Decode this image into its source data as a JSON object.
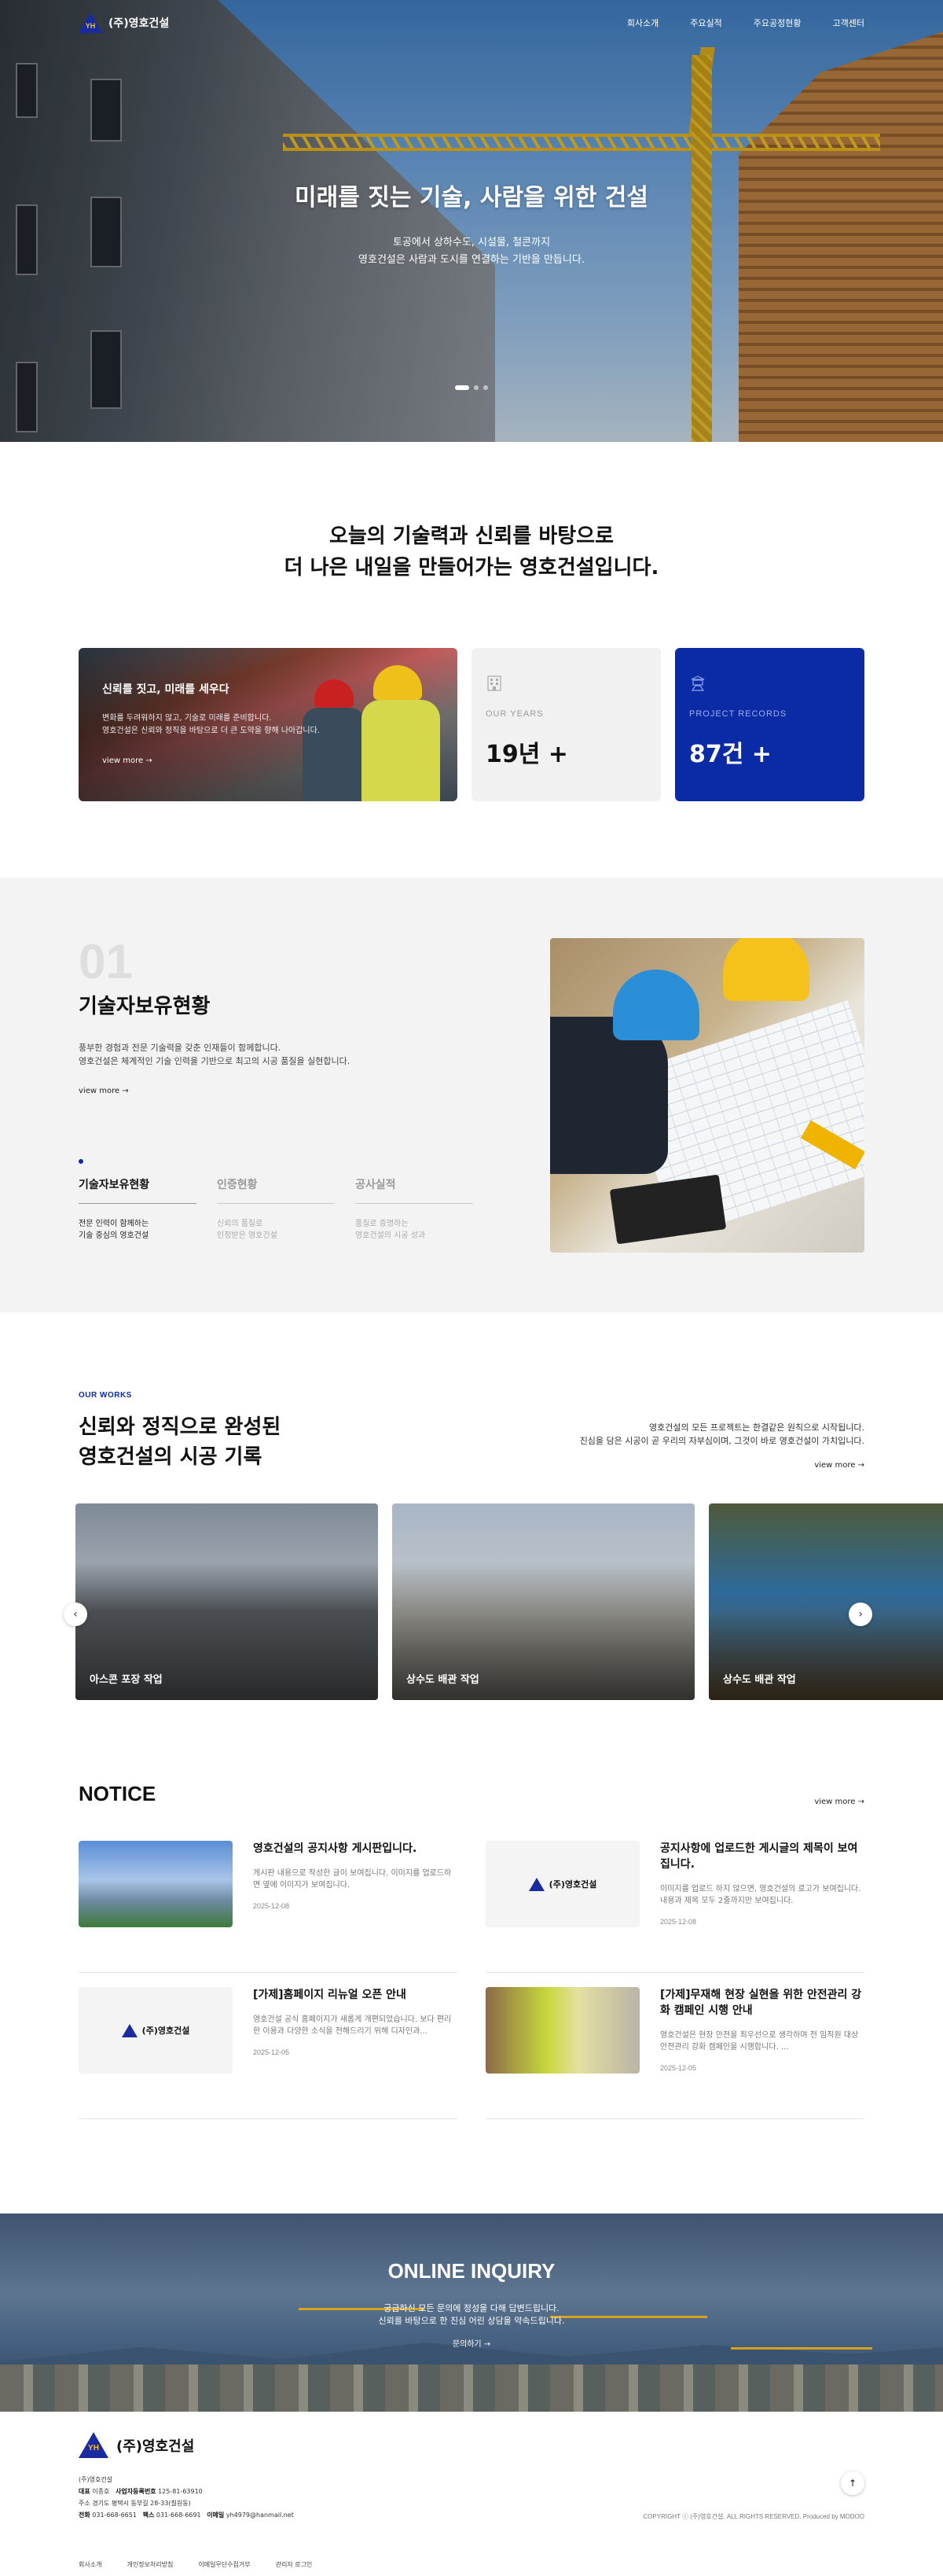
{
  "header": {
    "logo_text": "(주)영호건설",
    "logo_mark": "YH",
    "menu": [
      "회사소개",
      "주요실적",
      "주요공정현황",
      "고객센터"
    ]
  },
  "hero": {
    "title": "미래를 짓는 기술, 사람을 위한 건설",
    "subtitle_1": "토공에서 상하수도, 시설물, 철콘까지",
    "subtitle_2": "영호건설은 사람과 도시를 연결하는 기반을 만듭니다.",
    "slide_count": 3,
    "active_slide": 1
  },
  "intro": {
    "headline_1": "오늘의 기술력과 신뢰를 바탕으로",
    "headline_2": "더 나은 내일을 만들어가는 영호건설입니다.",
    "feature_card": {
      "title": "신뢰를 짓고, 미래를 세우다",
      "line_1": "변화를 두려워하지 않고, 기술로 미래를 준비합니다.",
      "line_2": "영호건설은 신뢰와 정직을 바탕으로 더 큰 도약을 향해 나아갑니다.",
      "link": "view more →"
    },
    "stats": [
      {
        "label": "OUR YEARS",
        "value": "19년 +",
        "icon": "building-icon"
      },
      {
        "label": "PROJECT RECORDS",
        "value": "87건 +",
        "icon": "record-icon"
      }
    ]
  },
  "tech": {
    "number": "01",
    "title": "기술자보유현황",
    "desc_1": "풍부한 경험과 전문 기술력을 갖춘 인재들이 함께합니다.",
    "desc_2": "영호건설은 체계적인 기술 인력을 기반으로 최고의 시공 품질을 실현합니다.",
    "link": "view more →",
    "tabs": [
      {
        "label": "기술자보유현황",
        "sub_1": "전문 인력이 함께하는",
        "sub_2": "기술 중심의 영호건설"
      },
      {
        "label": "인증현황",
        "sub_1": "신뢰의 품질로",
        "sub_2": "인정받은 영호건설"
      },
      {
        "label": "공사실적",
        "sub_1": "품질로 증명하는",
        "sub_2": "영호건설의 시공 성과"
      }
    ]
  },
  "works": {
    "eyebrow": "OUR WORKS",
    "title_1": "신뢰와 정직으로 완성된",
    "title_2": "영호건설의 시공 기록",
    "desc_1": "영호건설의 모든 프로젝트는 한결같은 원칙으로 시작됩니다.",
    "desc_2": "진심을 담은 시공이 곧 우리의 자부심이며, 그것이 바로 영호건설이 가치입니다.",
    "link": "view more →",
    "slides": [
      "아스콘 포장 작업",
      "상수도 배관 작업",
      "상수도 배관 작업"
    ],
    "prev": "‹",
    "next": "›"
  },
  "notice": {
    "title": "NOTICE",
    "link": "view more →",
    "thumb_logo": "(주)영호건설",
    "posts": [
      {
        "title": "영호건설의 공지사항 게시판입니다.",
        "body": "게시판 내용으로 작성한 글이 보여집니다. 이미지를 업로드하면 옆에 이미지가 보여집니다.",
        "date": "2025-12-08"
      },
      {
        "title": "공지사항에 업로드한 게시글의 제목이 보여집니다.",
        "body": "이미지를 업로드 하지 않으면, 영호건설의 로고가 보여집니다. 내용과 제목 모두 2줄까지만 보여집니다.",
        "date": "2025-12-08"
      },
      {
        "title": "[가제]홈페이지 리뉴얼 오픈 안내",
        "body": "영호건설 공식 홈페이지가 새롭게 개편되었습니다. 보다 편리한 이용과 다양한 소식을 전해드리기 위해 디자인과...",
        "date": "2025-12-05"
      },
      {
        "title": "[가제]무재해 현장 실현을 위한 안전관리 강화 캠페인 시행 안내",
        "body": "영호건설은 현장 안전을 최우선으로 생각하며 전 임직원 대상 안전관리 강화 캠페인을 시행합니다. ...",
        "date": "2025-12-05"
      }
    ]
  },
  "inquiry": {
    "title": "ONLINE INQUIRY",
    "line_1": "궁금하신 모든 문의에 정성을 다해 답변드립니다.",
    "line_2": "신뢰를 바탕으로 한 진심 어린 상담을 약속드립니다.",
    "button": "문의하기 →"
  },
  "footer": {
    "logo_text": "(주)영호건설",
    "company": "(주)영호건설",
    "rep_label": "대표",
    "rep": "이종호",
    "biz_label": "사업자등록번호",
    "biz": "125-81-63910",
    "address": "주소 경기도 평택시 동부길 28-33(칠원동)",
    "tel_label": "전화",
    "tel": "031-668-6651",
    "fax_label": "팩스",
    "fax": "031-668-6691",
    "email_label": "이메일",
    "email": "yh4979@hanmail.net",
    "copyright": "COPYRIGHT ⓒ (주)영호건설. ALL RIGHTS RESERVED. Produced by MODOO",
    "links": [
      "회사소개",
      "개인정보처리방침",
      "이메일무단수집거부",
      "관리자 로그인"
    ],
    "top": "↑"
  }
}
